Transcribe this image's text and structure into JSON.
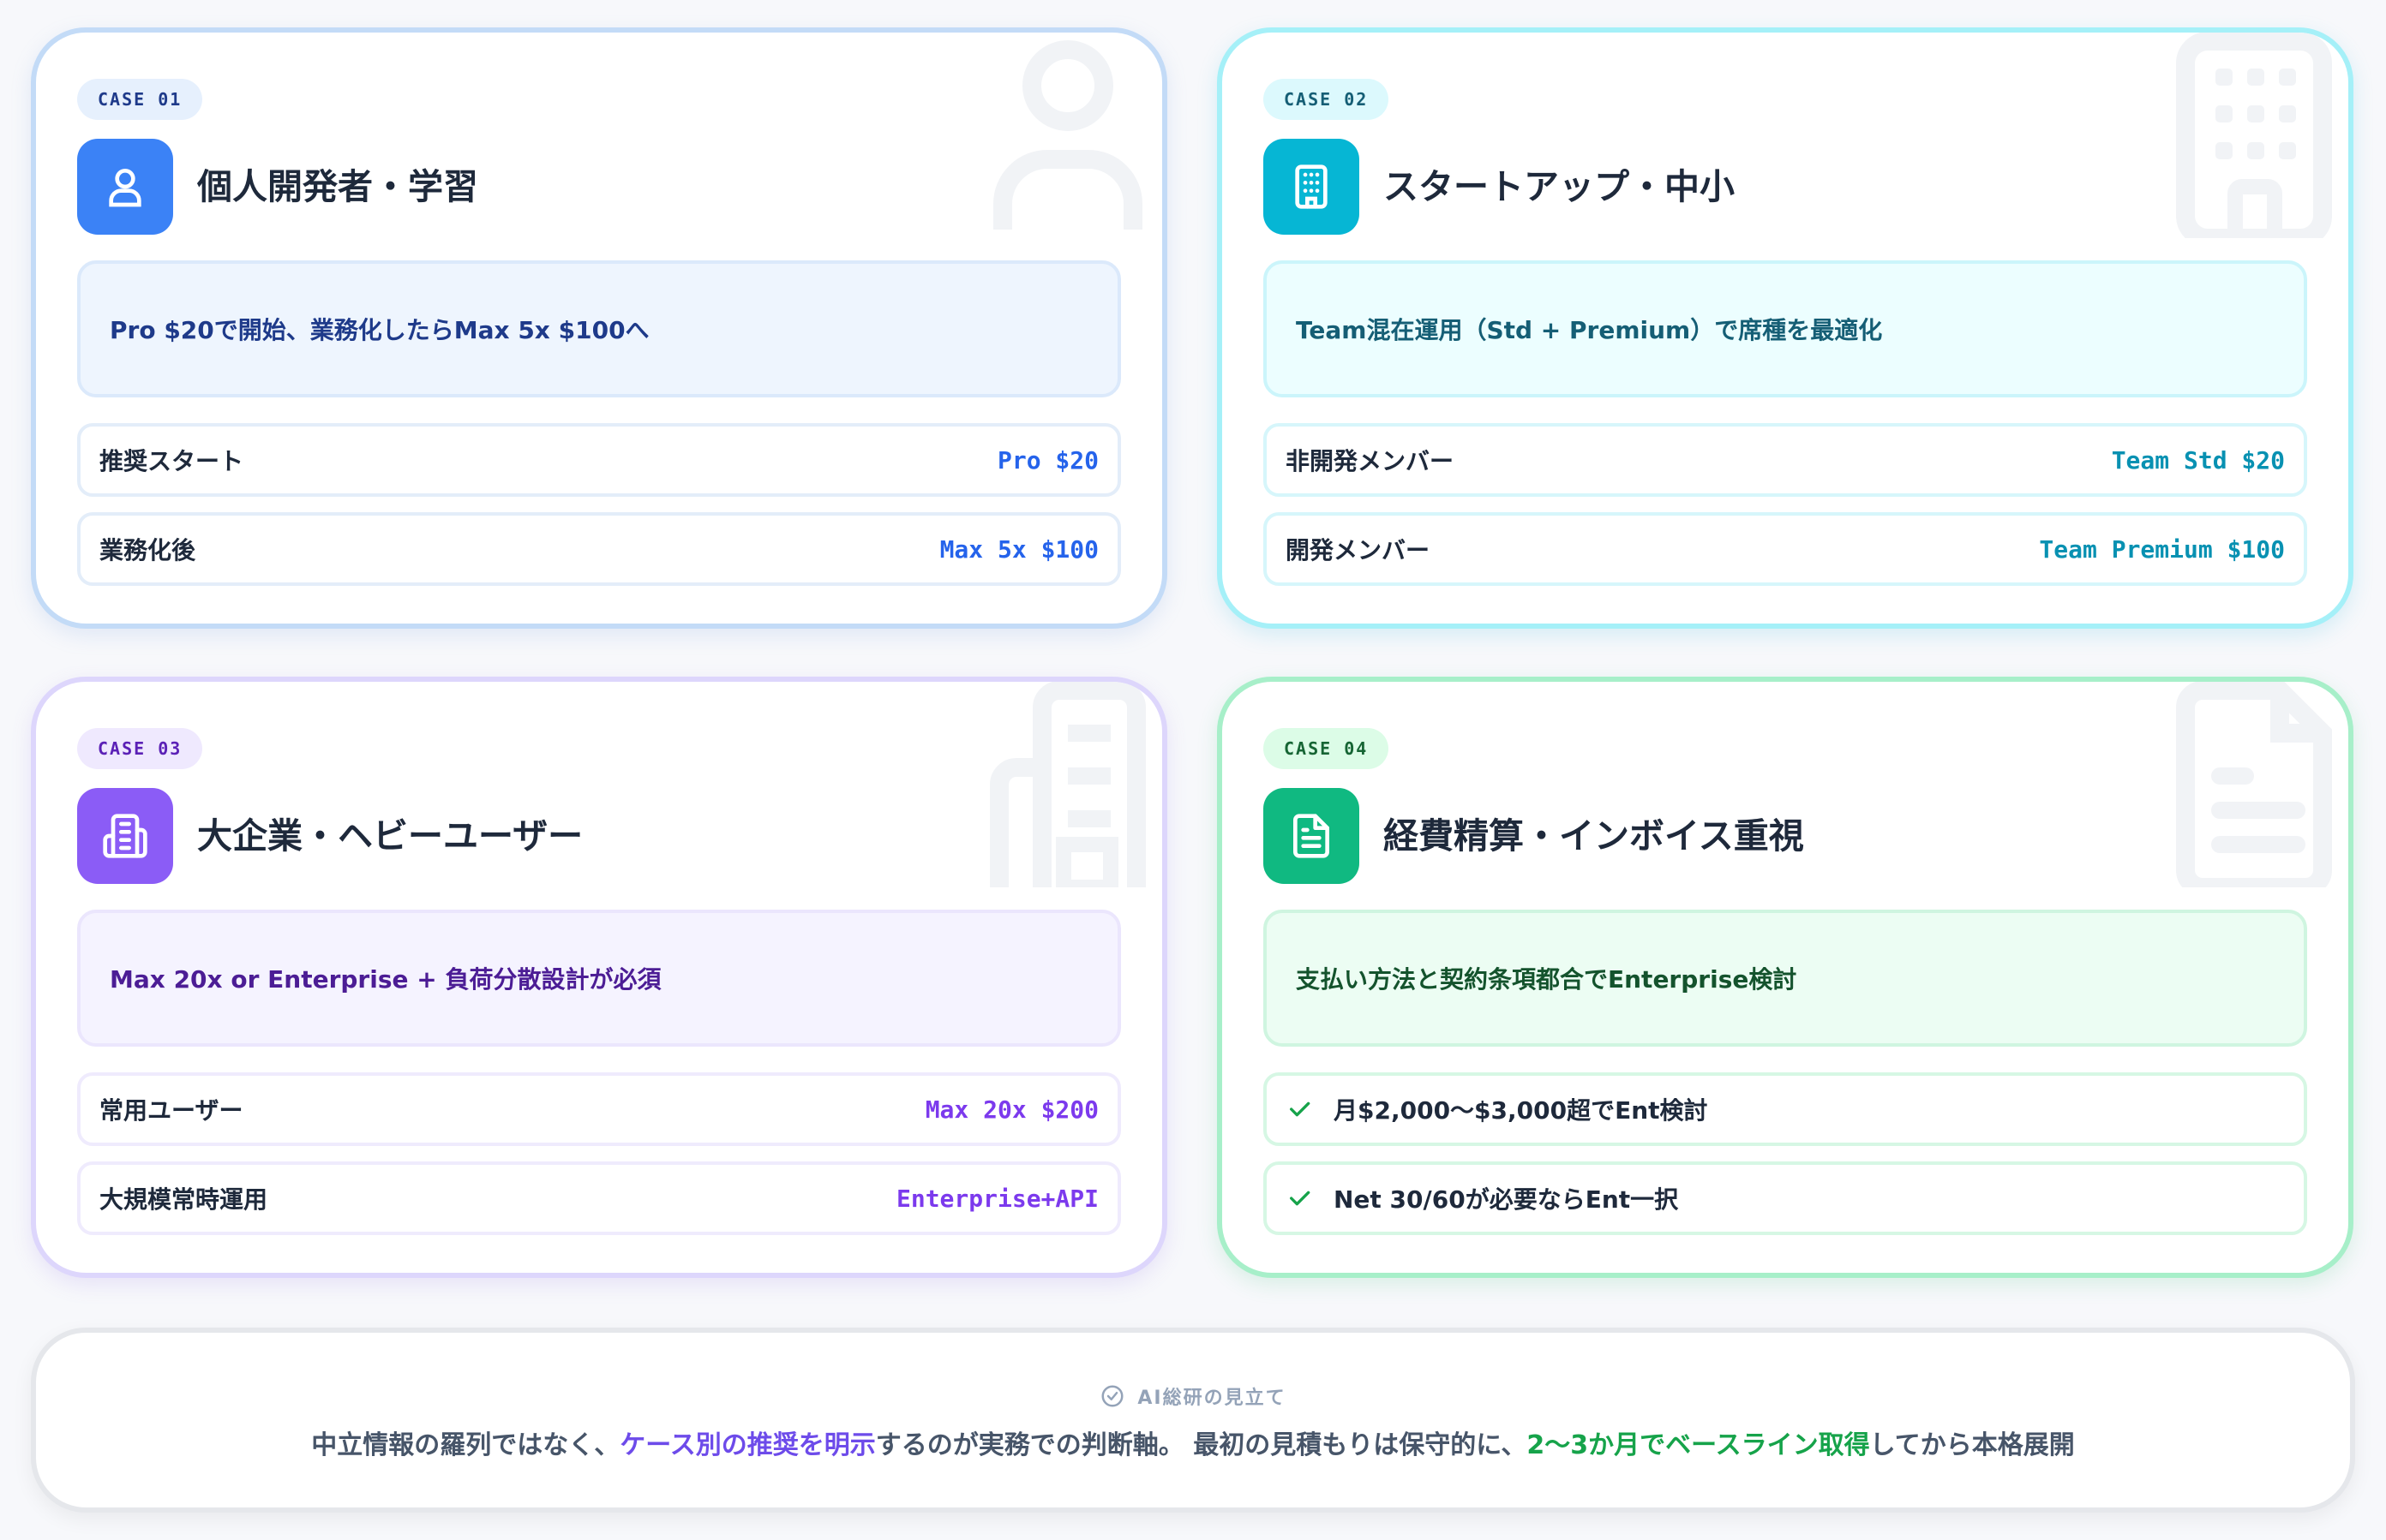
{
  "cases": [
    {
      "badge": "CASE 01",
      "icon": "user-icon",
      "title": "個人開発者・学習",
      "summary": "Pro $20で開始、業務化したらMax 5x $100へ",
      "rows": [
        {
          "label": "推奨スタート",
          "value": "Pro $20"
        },
        {
          "label": "業務化後",
          "value": "Max 5x $100"
        }
      ],
      "colors": {
        "accent": "#3b82f6",
        "badge_bg": "#e6f0fd",
        "badge_text": "#1e3a8a",
        "summary_bg": "#eef5fe",
        "summary_text": "#1e3a8a",
        "value": "#2563eb"
      }
    },
    {
      "badge": "CASE 02",
      "icon": "building-icon",
      "title": "スタートアップ・中小",
      "summary": "Team混在運用（Std + Premium）で席種を最適化",
      "rows": [
        {
          "label": "非開発メンバー",
          "value": "Team Std $20"
        },
        {
          "label": "開発メンバー",
          "value": "Team Premium $100"
        }
      ],
      "colors": {
        "accent": "#06b6d4",
        "badge_bg": "#dcf9fd",
        "badge_text": "#155e75",
        "summary_bg": "#ecfeff",
        "summary_text": "#155e75",
        "value": "#0891b2"
      }
    },
    {
      "badge": "CASE 03",
      "icon": "office-building-icon",
      "title": "大企業・ヘビーユーザー",
      "summary": "Max 20x or Enterprise + 負荷分散設計が必須",
      "rows": [
        {
          "label": "常用ユーザー",
          "value": "Max 20x $200"
        },
        {
          "label": "大規模常時運用",
          "value": "Enterprise+API"
        }
      ],
      "colors": {
        "accent": "#8b5cf6",
        "badge_bg": "#efe9fe",
        "badge_text": "#5b21b6",
        "summary_bg": "#f5f3ff",
        "summary_text": "#4c1d95",
        "value": "#7c3aed"
      }
    },
    {
      "badge": "CASE 04",
      "icon": "document-icon",
      "title": "経費精算・インボイス重視",
      "summary": "支払い方法と契約条項都合でEnterprise検討",
      "rows": [
        {
          "label": "月$2,000〜$3,000超でEnt検討"
        },
        {
          "label": "Net 30/60が必要ならEnt一択"
        }
      ],
      "colors": {
        "accent": "#10b981",
        "badge_bg": "#dcfce7",
        "badge_text": "#166534",
        "summary_bg": "#ecfdf3",
        "summary_text": "#14532d",
        "value": "#16a34a"
      }
    }
  ],
  "footer": {
    "heading": "AI総研の見立て",
    "text_1": "中立情報の羅列ではなく、",
    "highlight_1": "ケース別の推奨を明示",
    "text_2": "するのが実務での判断軸。 最初の見積もりは保守的に、",
    "highlight_2": "2〜3か月でベースライン取得",
    "text_3": "してから本格展開"
  }
}
